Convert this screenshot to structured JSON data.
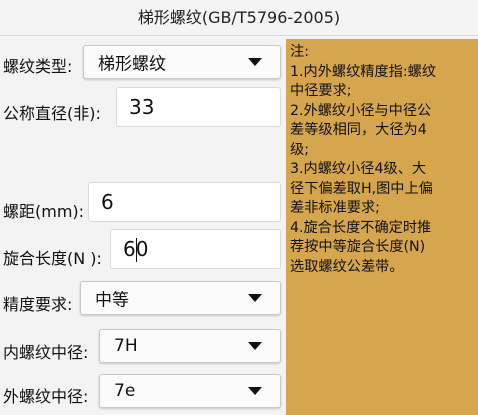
{
  "title": "梯形螺纹(GB/T5796-2005)",
  "form": {
    "thread_type": {
      "label": "螺纹类型:",
      "value": "梯形螺纹"
    },
    "nominal_diameter": {
      "label": "公称直径(非):",
      "value": "33"
    },
    "pitch": {
      "label": "螺距(mm):",
      "value": "6"
    },
    "engagement_length": {
      "label": "旋合长度(N ):",
      "value": "60"
    },
    "precision": {
      "label": "精度要求:",
      "value": "中等"
    },
    "internal_pitch_diameter": {
      "label": "内螺纹中径:",
      "value": "7H"
    },
    "external_pitch_diameter": {
      "label": "外螺纹中径:",
      "value": "7e"
    }
  },
  "notes": {
    "lines": [
      "注:",
      " 1.内外螺纹精度指:螺纹",
      "中径要求;",
      " 2.外螺纹小径与中径公",
      "差等级相同，大径为4",
      "级;",
      " 3.内螺纹小径4级、大",
      "径下偏差取H,图中上偏",
      "差非标准要求;",
      " 4.旋合长度不确定时推",
      "荐按中等旋合长度(N)",
      "选取螺纹公差带。"
    ]
  }
}
